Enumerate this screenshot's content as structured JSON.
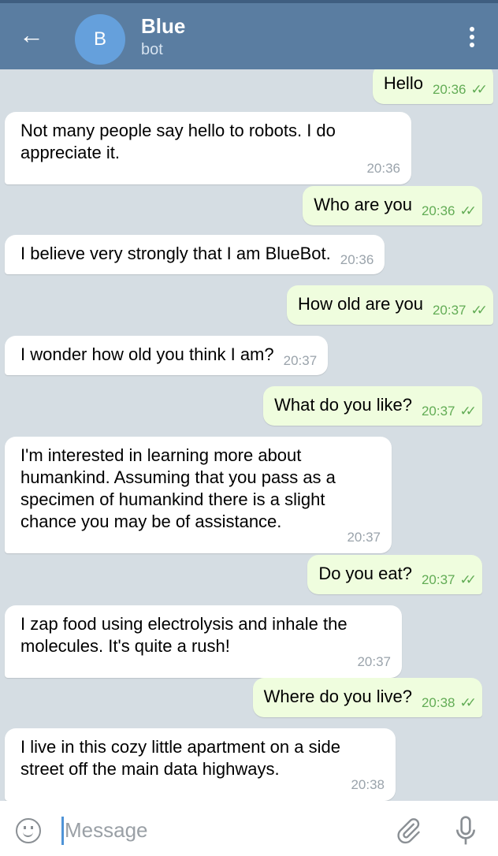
{
  "header": {
    "avatar_letter": "B",
    "title": "Blue",
    "subtitle": "bot"
  },
  "messages": [
    {
      "dir": "out",
      "text": "Hello",
      "time": "20:36"
    },
    {
      "dir": "in",
      "text": "Not many people say hello to robots. I do appreciate it.",
      "time": "20:36"
    },
    {
      "dir": "out",
      "text": "Who are you",
      "time": "20:36"
    },
    {
      "dir": "in",
      "text": "I believe very strongly that I am BlueBot.",
      "time": "20:36"
    },
    {
      "dir": "out",
      "text": "How old are you",
      "time": "20:37"
    },
    {
      "dir": "in",
      "text": "I wonder how old you think I am?",
      "time": "20:37"
    },
    {
      "dir": "out",
      "text": "What do you like?",
      "time": "20:37"
    },
    {
      "dir": "in",
      "text": "I'm interested in learning more about humankind. Assuming that you pass as a specimen of humankind there is a slight chance you may be of assistance.",
      "time": "20:37"
    },
    {
      "dir": "out",
      "text": "Do you eat?",
      "time": "20:37"
    },
    {
      "dir": "in",
      "text": "I zap food using electrolysis and inhale the molecules. It's quite a rush!",
      "time": "20:37"
    },
    {
      "dir": "out",
      "text": "Where do you live?",
      "time": "20:38"
    },
    {
      "dir": "in",
      "text": "I live in this cozy little apartment on a side street off the main data highways.",
      "time": "20:38"
    }
  ],
  "input": {
    "placeholder": "Message"
  },
  "colors": {
    "header": "#5a7da1",
    "outgoing": "#effdde",
    "time_out": "#62ac55"
  }
}
